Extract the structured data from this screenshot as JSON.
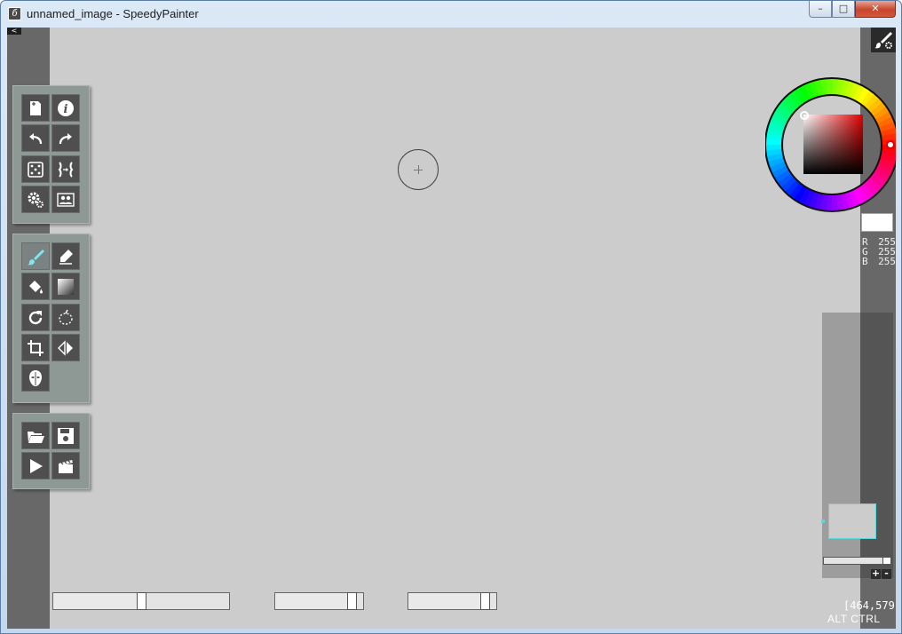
{
  "window": {
    "title": "unnamed_image - SpeedyPainter",
    "app_icon_glyph": "б",
    "controls": {
      "minimize": "–",
      "maximize": "□",
      "close": "✕"
    }
  },
  "collapse_toggle": "<",
  "panels": {
    "file_tools": [
      {
        "name": "new-image",
        "icon": "new-document-icon"
      },
      {
        "name": "info",
        "icon": "info-icon"
      },
      {
        "name": "undo",
        "icon": "undo-icon"
      },
      {
        "name": "redo",
        "icon": "redo-icon"
      },
      {
        "name": "random-brush",
        "icon": "dice-icon"
      },
      {
        "name": "mirror-view",
        "icon": "mirror-icon"
      },
      {
        "name": "settings",
        "icon": "gears-icon"
      },
      {
        "name": "reference",
        "icon": "people-icon"
      }
    ],
    "drawing_tools": [
      {
        "name": "brush",
        "icon": "brush-icon",
        "active": true
      },
      {
        "name": "eraser",
        "icon": "eraser-icon"
      },
      {
        "name": "fill",
        "icon": "bucket-icon"
      },
      {
        "name": "gradient",
        "icon": "gradient-icon"
      },
      {
        "name": "rotate",
        "icon": "rotate-icon"
      },
      {
        "name": "lasso",
        "icon": "lasso-icon"
      },
      {
        "name": "crop",
        "icon": "crop-icon"
      },
      {
        "name": "flip",
        "icon": "flip-icon"
      },
      {
        "name": "mask",
        "icon": "mask-icon"
      }
    ],
    "media_tools": [
      {
        "name": "open",
        "icon": "folder-icon"
      },
      {
        "name": "save",
        "icon": "floppy-icon"
      },
      {
        "name": "play",
        "icon": "play-icon"
      },
      {
        "name": "record",
        "icon": "clapperboard-icon"
      }
    ]
  },
  "color": {
    "current": "#ffffff",
    "r_label": "R",
    "r": "255",
    "g_label": "G",
    "g": "255",
    "b_label": "B",
    "b": "255"
  },
  "navigator": {
    "zoom_in": "+",
    "zoom_out": "-",
    "zoom_level": 0.9
  },
  "sliders": {
    "brush_size": 0.5,
    "opacity": 0.92,
    "flow": 0.92
  },
  "status": {
    "coords": "[464,579]",
    "modifiers": "ALT CTRL"
  }
}
